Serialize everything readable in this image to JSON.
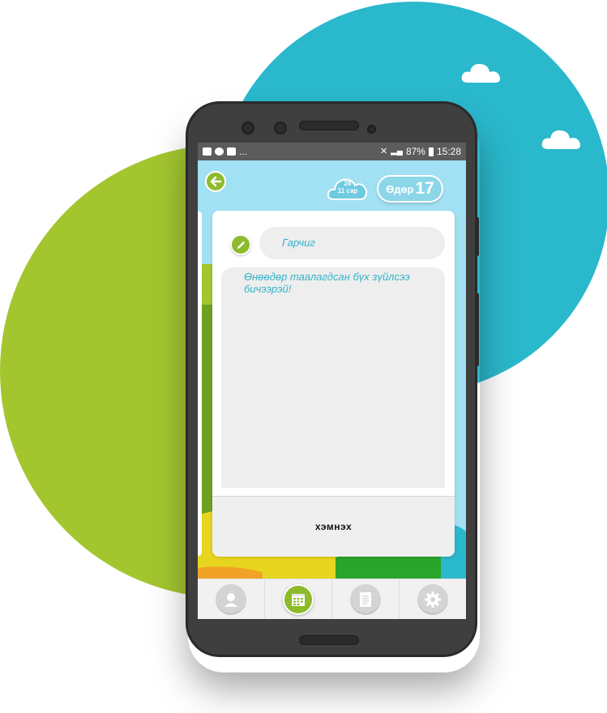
{
  "status_bar": {
    "dots": "...",
    "battery": "87%",
    "time": "15:28"
  },
  "header": {
    "date_day": "28",
    "date_month": "11 сар",
    "day_label": "Өдөр",
    "day_number": "17"
  },
  "form": {
    "title_placeholder": "Гарчиг",
    "body_placeholder": "Өнөөдөр таалагдсан бүх зүйлсээ бичээрэй!",
    "save_label": "хэмнэх"
  },
  "nav": {
    "items": [
      {
        "icon": "profile-icon",
        "active": false
      },
      {
        "icon": "calendar-icon",
        "active": true
      },
      {
        "icon": "notes-icon",
        "active": false
      },
      {
        "icon": "settings-icon",
        "active": false
      }
    ]
  },
  "colors": {
    "accent_green": "#8dbb2b",
    "accent_blue": "#2fb3c9",
    "background_blue_circle": "#2ab8cc",
    "background_green_circle": "#a3c62f"
  }
}
